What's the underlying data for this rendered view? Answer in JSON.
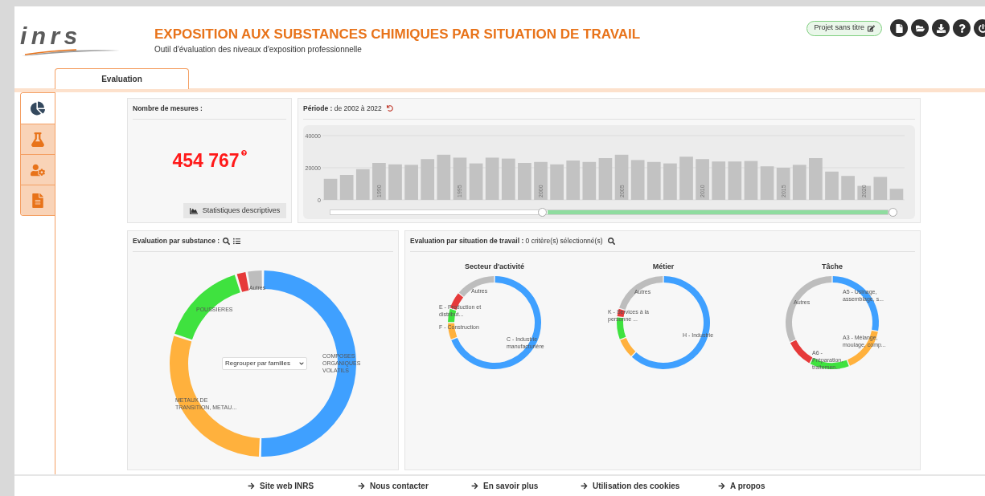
{
  "header": {
    "logo": "inrs",
    "title": "EXPOSITION AUX SUBSTANCES CHIMIQUES PAR SITUATION DE TRAVAIL",
    "subtitle": "Outil d'évaluation des niveaux d'exposition professionnelle",
    "project": "Projet sans titre",
    "toolbar": [
      {
        "kind": "new"
      },
      {
        "kind": "open"
      },
      {
        "kind": "download"
      },
      {
        "kind": "help"
      },
      {
        "kind": "power"
      }
    ]
  },
  "tabs": [
    {
      "label": "Evaluation",
      "selected": true
    }
  ],
  "side_tabs": [
    {
      "kind": "charts",
      "selected": true
    },
    {
      "kind": "substances",
      "selected": false
    },
    {
      "kind": "workers",
      "selected": false
    },
    {
      "kind": "report",
      "selected": false
    }
  ],
  "measures": {
    "title": "Nombre de mesures :",
    "count": "454 767",
    "button": "Statistiques descriptives"
  },
  "period": {
    "title": "**Période :** de 2002 à 2022",
    "chart_data": {
      "type": "bar",
      "x": [
        1987,
        1988,
        1989,
        1990,
        1991,
        1992,
        1993,
        1994,
        1995,
        1996,
        1997,
        1998,
        1999,
        2000,
        2001,
        2002,
        2003,
        2004,
        2005,
        2006,
        2007,
        2008,
        2009,
        2010,
        2011,
        2012,
        2013,
        2014,
        2015,
        2016,
        2017,
        2018,
        2019,
        2020,
        2021,
        2022
      ],
      "values": [
        13100,
        15500,
        19100,
        23000,
        22100,
        21800,
        25400,
        28100,
        26300,
        22700,
        26300,
        25700,
        23000,
        23600,
        22100,
        24500,
        23600,
        26000,
        28100,
        24800,
        23600,
        22700,
        26900,
        25400,
        23900,
        23900,
        24200,
        20900,
        20000,
        21800,
        26000,
        17600,
        14900,
        8700,
        14300,
        6900
      ],
      "xlim": [
        1986.5,
        2022.5
      ],
      "ylim": [
        0,
        40000
      ],
      "yticks": [
        0,
        20000,
        40000
      ],
      "xticks": [
        1990,
        1995,
        2000,
        2005,
        2010,
        2015,
        2020
      ]
    },
    "slider": {
      "level": 0.61
    }
  },
  "substance": {
    "title": "Evaluation par substance :",
    "select": "Regrouper par familles",
    "segments": [
      {
        "color": "#3fa0ff"
      },
      {
        "color": "#ffb13d"
      },
      {
        "color": "#3fe23f"
      },
      {
        "color": "#e63a3a"
      },
      {
        "color": "#bdbdbd"
      }
    ],
    "labels": [
      "Autres",
      "POUSSIERES",
      "COMPOSES ORGANIQUES VOLATILS",
      "METAUX DE TRANSITION, METAU..."
    ]
  },
  "situation": {
    "title": "**Evaluation par situation de travail :** 0 critère(s) sélectionné(s)",
    "charts": [
      {
        "title": "Secteur d'activité",
        "segments": [
          {
            "color": "#3fa0ff"
          },
          {
            "color": "#ffb13d"
          },
          {
            "color": "#3fe23f"
          },
          {
            "color": "#e63a3a"
          },
          {
            "color": "#bdbdbd"
          }
        ],
        "labels": [
          "Autres",
          "E - Production et distribut...",
          "F - Construction",
          "C - Industrie manufacturière"
        ]
      },
      {
        "title": "Métier",
        "segments": [
          {
            "color": "#3fa0ff"
          },
          {
            "color": "#ffb13d"
          },
          {
            "color": "#3fe23f"
          },
          {
            "color": "#e63a3a"
          },
          {
            "color": "#bdbdbd"
          }
        ],
        "labels": [
          "Autres",
          "K - Services à la personne ...",
          "H - Industrie"
        ]
      },
      {
        "title": "Tâche",
        "segments": [
          {
            "color": "#3fa0ff"
          },
          {
            "color": "#ffb13d"
          },
          {
            "color": "#3fe23f"
          },
          {
            "color": "#e63a3a"
          },
          {
            "color": "#bdbdbd"
          }
        ],
        "labels": [
          "A5 - Usinage, assemblage, s...",
          "Autres",
          "A3 - Mélange, moulage, comp...",
          "A6 - Préparation, traitemen..."
        ]
      }
    ]
  },
  "footer": {
    "links": [
      "Site web INRS",
      "Nous contacter",
      "En savoir plus",
      "Utilisation des cookies",
      "A propos"
    ]
  }
}
